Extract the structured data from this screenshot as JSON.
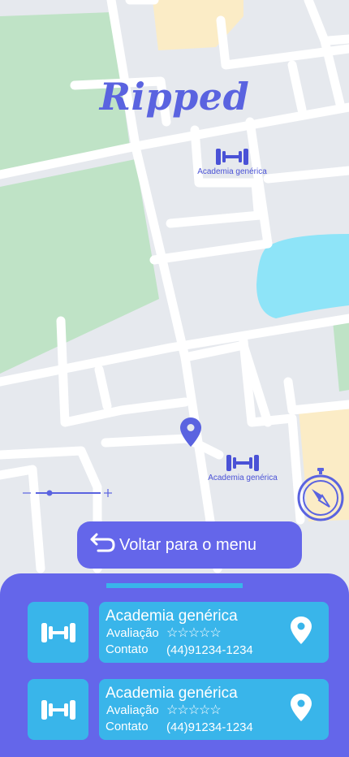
{
  "app": {
    "logo_text": "Ripped"
  },
  "map": {
    "markers": [
      {
        "label": "Academia genérica"
      },
      {
        "label": "Academia genérica"
      }
    ]
  },
  "back_button": {
    "label": "Voltar para o menu"
  },
  "results": [
    {
      "name": "Academia genérica",
      "rating_label": "Avaliação",
      "rating_stars": "☆☆☆☆☆",
      "rating": 0,
      "contact_label": "Contato",
      "phone": "(44)91234-1234"
    },
    {
      "name": "Academia genérica",
      "rating_label": "Avaliação",
      "rating_stars": "☆☆☆☆☆",
      "rating": 0,
      "contact_label": "Contato",
      "phone": "(44)91234-1234"
    }
  ],
  "colors": {
    "accent": "#6466ea",
    "secondary": "#39b5ea",
    "park": "#bfe3c6",
    "water": "#8ee4f8"
  }
}
